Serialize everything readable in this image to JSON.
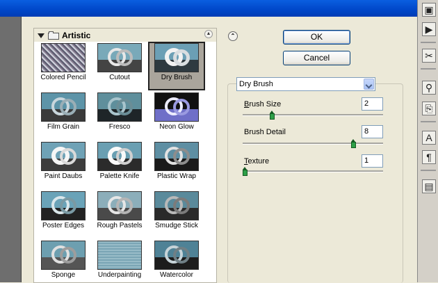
{
  "gallery": {
    "folder_name": "Artistic",
    "filters": [
      {
        "label": "Colored Pencil"
      },
      {
        "label": "Cutout"
      },
      {
        "label": "Dry Brush",
        "selected": true
      },
      {
        "label": "Film Grain"
      },
      {
        "label": "Fresco"
      },
      {
        "label": "Neon Glow"
      },
      {
        "label": "Paint Daubs"
      },
      {
        "label": "Palette Knife"
      },
      {
        "label": "Plastic Wrap"
      },
      {
        "label": "Poster Edges"
      },
      {
        "label": "Rough Pastels"
      },
      {
        "label": "Smudge Stick"
      },
      {
        "label": "Sponge"
      },
      {
        "label": "Underpainting"
      },
      {
        "label": "Watercolor"
      }
    ]
  },
  "buttons": {
    "ok": "OK",
    "cancel": "Cancel"
  },
  "filter_select": {
    "selected": "Dry Brush"
  },
  "params": [
    {
      "label": "Brush Size",
      "accel": "B",
      "rest": "rush Size",
      "value": "2",
      "fraction": 0.2
    },
    {
      "label": "Brush Detail",
      "accel": "",
      "rest": "Brush Detail",
      "value": "8",
      "fraction": 0.8
    },
    {
      "label": "Texture",
      "accel": "T",
      "rest": "exture",
      "value": "1",
      "fraction": 0.0
    }
  ],
  "colors": {
    "titlebar": "#0046c8",
    "knob": "#2ea048",
    "selected_thumb": "#aaa59c"
  }
}
